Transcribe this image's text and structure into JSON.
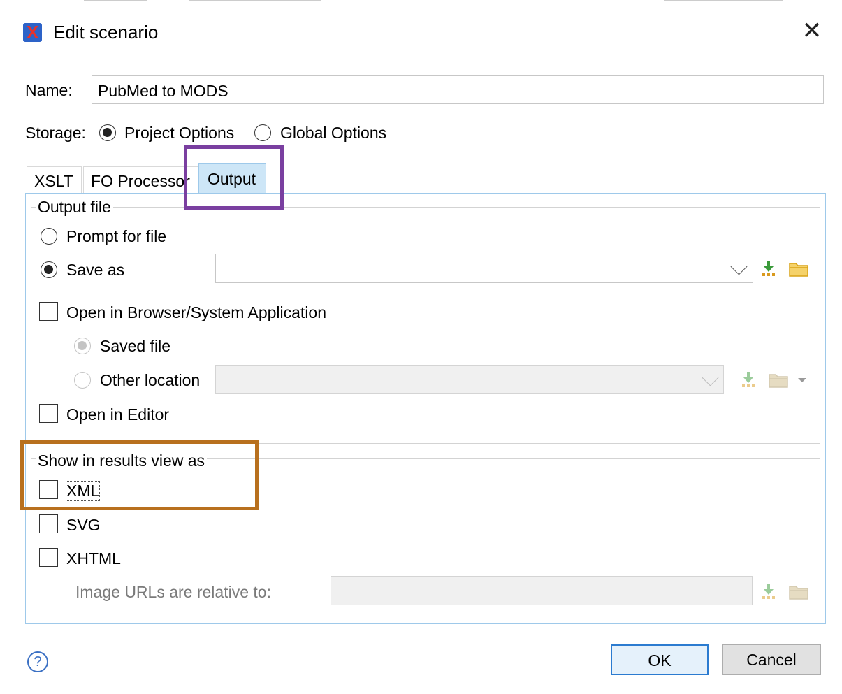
{
  "window": {
    "title": "Edit scenario",
    "app_icon_glyph": "X",
    "close_glyph": "✕"
  },
  "name_field": {
    "label": "Name:",
    "value": "PubMed to MODS"
  },
  "storage": {
    "label": "Storage:",
    "options": [
      {
        "label": "Project Options",
        "selected": true
      },
      {
        "label": "Global Options",
        "selected": false
      }
    ]
  },
  "tabs": [
    {
      "label": "XSLT",
      "active": false
    },
    {
      "label": "FO Processor",
      "active": false
    },
    {
      "label": "Output",
      "active": true
    }
  ],
  "output_file": {
    "group_title": "Output file",
    "prompt_label": "Prompt for file",
    "save_as_label": "Save as",
    "save_as_value": "",
    "open_browser_label": "Open in Browser/System Application",
    "saved_file_label": "Saved file",
    "other_location_label": "Other location",
    "open_editor_label": "Open in Editor"
  },
  "results_view": {
    "group_title": "Show in results view as",
    "xml_label": "XML",
    "svg_label": "SVG",
    "xhtml_label": "XHTML",
    "image_urls_label": "Image URLs are relative to:"
  },
  "footer": {
    "help_glyph": "?",
    "ok_label": "OK",
    "cancel_label": "Cancel"
  },
  "colors": {
    "active_tab": "#cde6f7",
    "highlight_purple": "#7a3fa0",
    "highlight_orange": "#b8701e",
    "ok_border": "#2b7bd0",
    "icon_green": "#3a9a3a",
    "icon_folder": "#e8b923"
  },
  "icons": [
    "app-icon",
    "close-icon",
    "chevron-down-icon",
    "download-icon",
    "folder-icon",
    "help-icon"
  ]
}
